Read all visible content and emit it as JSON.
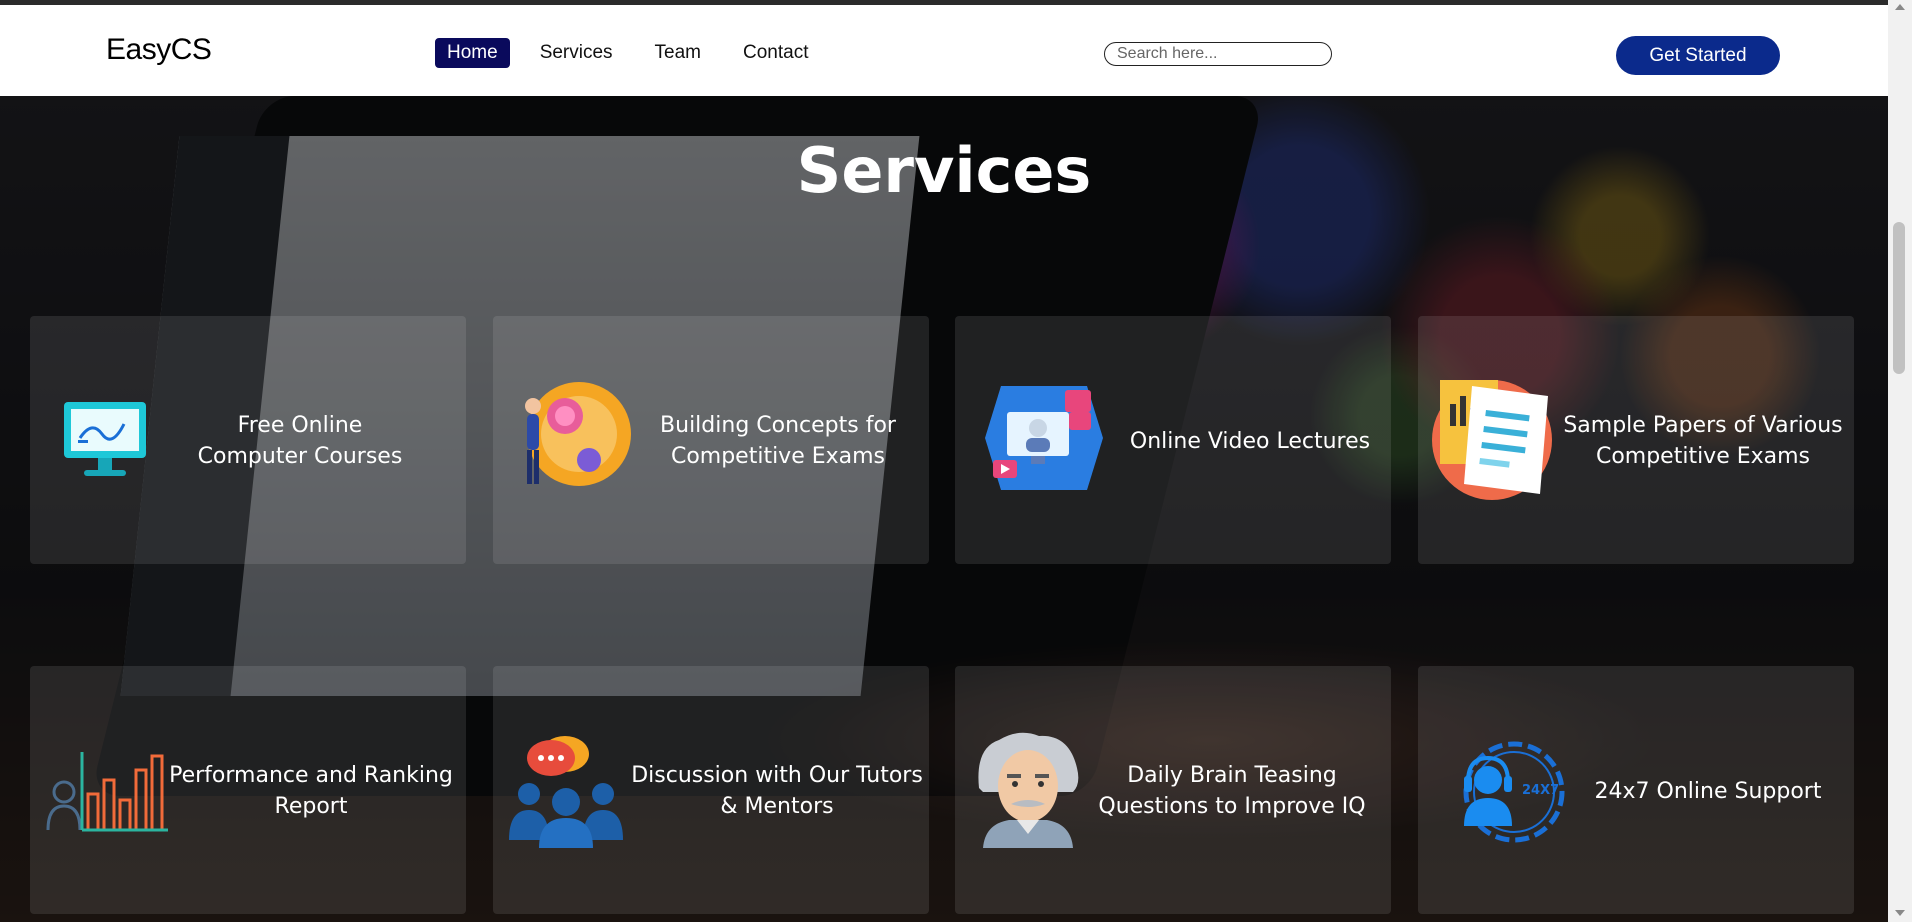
{
  "nav": {
    "logo": "EasyCS",
    "links": [
      "Home",
      "Services",
      "Team",
      "Contact"
    ],
    "search_placeholder": "Search here...",
    "cta_label": "Get Started"
  },
  "services": {
    "title": "Services",
    "cards": [
      {
        "label": "Free Online Computer Courses",
        "icon": "computer-monitor-icon"
      },
      {
        "label": "Building Concepts for Competitive Exams",
        "icon": "brain-idea-icon"
      },
      {
        "label": "Online Video Lectures",
        "icon": "video-lecture-icon"
      },
      {
        "label": "Sample Papers of Various Competitive Exams",
        "icon": "sample-papers-icon"
      },
      {
        "label": "Performance and Ranking Report",
        "icon": "ranking-chart-icon"
      },
      {
        "label": "Discussion with Our Tutors & Mentors",
        "icon": "discussion-group-icon"
      },
      {
        "label": "Daily Brain Teasing Questions to Improve IQ",
        "icon": "einstein-icon"
      },
      {
        "label": "24x7 Online Support",
        "icon": "support-headset-icon"
      }
    ],
    "support_icon_text": "24X7"
  },
  "colors": {
    "nav_active": "#0a0a5c",
    "cta": "#0b2a8c"
  }
}
